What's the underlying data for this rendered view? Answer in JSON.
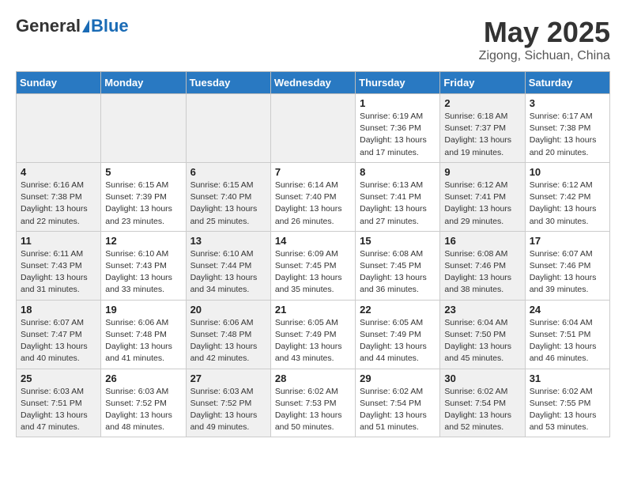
{
  "header": {
    "logo_general": "General",
    "logo_blue": "Blue",
    "title": "May 2025",
    "subtitle": "Zigong, Sichuan, China"
  },
  "days_of_week": [
    "Sunday",
    "Monday",
    "Tuesday",
    "Wednesday",
    "Thursday",
    "Friday",
    "Saturday"
  ],
  "weeks": [
    [
      {
        "day": "",
        "content": "",
        "shaded": true
      },
      {
        "day": "",
        "content": "",
        "shaded": true
      },
      {
        "day": "",
        "content": "",
        "shaded": true
      },
      {
        "day": "",
        "content": "",
        "shaded": true
      },
      {
        "day": "1",
        "content": "Sunrise: 6:19 AM\nSunset: 7:36 PM\nDaylight: 13 hours\nand 17 minutes.",
        "shaded": false
      },
      {
        "day": "2",
        "content": "Sunrise: 6:18 AM\nSunset: 7:37 PM\nDaylight: 13 hours\nand 19 minutes.",
        "shaded": true
      },
      {
        "day": "3",
        "content": "Sunrise: 6:17 AM\nSunset: 7:38 PM\nDaylight: 13 hours\nand 20 minutes.",
        "shaded": false
      }
    ],
    [
      {
        "day": "4",
        "content": "Sunrise: 6:16 AM\nSunset: 7:38 PM\nDaylight: 13 hours\nand 22 minutes.",
        "shaded": true
      },
      {
        "day": "5",
        "content": "Sunrise: 6:15 AM\nSunset: 7:39 PM\nDaylight: 13 hours\nand 23 minutes.",
        "shaded": false
      },
      {
        "day": "6",
        "content": "Sunrise: 6:15 AM\nSunset: 7:40 PM\nDaylight: 13 hours\nand 25 minutes.",
        "shaded": true
      },
      {
        "day": "7",
        "content": "Sunrise: 6:14 AM\nSunset: 7:40 PM\nDaylight: 13 hours\nand 26 minutes.",
        "shaded": false
      },
      {
        "day": "8",
        "content": "Sunrise: 6:13 AM\nSunset: 7:41 PM\nDaylight: 13 hours\nand 27 minutes.",
        "shaded": false
      },
      {
        "day": "9",
        "content": "Sunrise: 6:12 AM\nSunset: 7:41 PM\nDaylight: 13 hours\nand 29 minutes.",
        "shaded": true
      },
      {
        "day": "10",
        "content": "Sunrise: 6:12 AM\nSunset: 7:42 PM\nDaylight: 13 hours\nand 30 minutes.",
        "shaded": false
      }
    ],
    [
      {
        "day": "11",
        "content": "Sunrise: 6:11 AM\nSunset: 7:43 PM\nDaylight: 13 hours\nand 31 minutes.",
        "shaded": true
      },
      {
        "day": "12",
        "content": "Sunrise: 6:10 AM\nSunset: 7:43 PM\nDaylight: 13 hours\nand 33 minutes.",
        "shaded": false
      },
      {
        "day": "13",
        "content": "Sunrise: 6:10 AM\nSunset: 7:44 PM\nDaylight: 13 hours\nand 34 minutes.",
        "shaded": true
      },
      {
        "day": "14",
        "content": "Sunrise: 6:09 AM\nSunset: 7:45 PM\nDaylight: 13 hours\nand 35 minutes.",
        "shaded": false
      },
      {
        "day": "15",
        "content": "Sunrise: 6:08 AM\nSunset: 7:45 PM\nDaylight: 13 hours\nand 36 minutes.",
        "shaded": false
      },
      {
        "day": "16",
        "content": "Sunrise: 6:08 AM\nSunset: 7:46 PM\nDaylight: 13 hours\nand 38 minutes.",
        "shaded": true
      },
      {
        "day": "17",
        "content": "Sunrise: 6:07 AM\nSunset: 7:46 PM\nDaylight: 13 hours\nand 39 minutes.",
        "shaded": false
      }
    ],
    [
      {
        "day": "18",
        "content": "Sunrise: 6:07 AM\nSunset: 7:47 PM\nDaylight: 13 hours\nand 40 minutes.",
        "shaded": true
      },
      {
        "day": "19",
        "content": "Sunrise: 6:06 AM\nSunset: 7:48 PM\nDaylight: 13 hours\nand 41 minutes.",
        "shaded": false
      },
      {
        "day": "20",
        "content": "Sunrise: 6:06 AM\nSunset: 7:48 PM\nDaylight: 13 hours\nand 42 minutes.",
        "shaded": true
      },
      {
        "day": "21",
        "content": "Sunrise: 6:05 AM\nSunset: 7:49 PM\nDaylight: 13 hours\nand 43 minutes.",
        "shaded": false
      },
      {
        "day": "22",
        "content": "Sunrise: 6:05 AM\nSunset: 7:49 PM\nDaylight: 13 hours\nand 44 minutes.",
        "shaded": false
      },
      {
        "day": "23",
        "content": "Sunrise: 6:04 AM\nSunset: 7:50 PM\nDaylight: 13 hours\nand 45 minutes.",
        "shaded": true
      },
      {
        "day": "24",
        "content": "Sunrise: 6:04 AM\nSunset: 7:51 PM\nDaylight: 13 hours\nand 46 minutes.",
        "shaded": false
      }
    ],
    [
      {
        "day": "25",
        "content": "Sunrise: 6:03 AM\nSunset: 7:51 PM\nDaylight: 13 hours\nand 47 minutes.",
        "shaded": true
      },
      {
        "day": "26",
        "content": "Sunrise: 6:03 AM\nSunset: 7:52 PM\nDaylight: 13 hours\nand 48 minutes.",
        "shaded": false
      },
      {
        "day": "27",
        "content": "Sunrise: 6:03 AM\nSunset: 7:52 PM\nDaylight: 13 hours\nand 49 minutes.",
        "shaded": true
      },
      {
        "day": "28",
        "content": "Sunrise: 6:02 AM\nSunset: 7:53 PM\nDaylight: 13 hours\nand 50 minutes.",
        "shaded": false
      },
      {
        "day": "29",
        "content": "Sunrise: 6:02 AM\nSunset: 7:54 PM\nDaylight: 13 hours\nand 51 minutes.",
        "shaded": false
      },
      {
        "day": "30",
        "content": "Sunrise: 6:02 AM\nSunset: 7:54 PM\nDaylight: 13 hours\nand 52 minutes.",
        "shaded": true
      },
      {
        "day": "31",
        "content": "Sunrise: 6:02 AM\nSunset: 7:55 PM\nDaylight: 13 hours\nand 53 minutes.",
        "shaded": false
      }
    ]
  ]
}
